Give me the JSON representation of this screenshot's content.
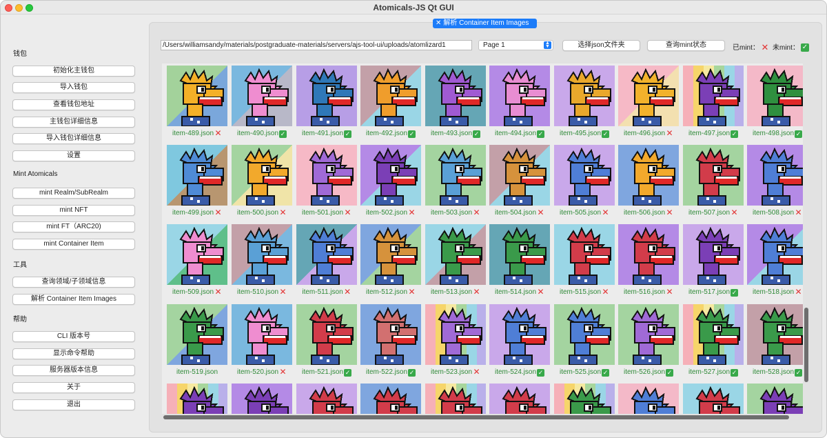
{
  "window": {
    "title": "Atomicals-JS Qt GUI"
  },
  "tab": {
    "label": "解析 Container Item Images",
    "close_glyph": "✕"
  },
  "sidebar": {
    "sections": [
      {
        "title": "钱包",
        "buttons": [
          "初始化主钱包",
          "导入钱包",
          "查看钱包地址",
          "主钱包详细信息",
          "导入钱包详细信息",
          "设置"
        ]
      },
      {
        "title": "Mint Atomicals",
        "buttons": [
          "mint Realm/SubRealm",
          "mint NFT",
          "mint FT（ARC20)",
          "mint Container Item"
        ]
      },
      {
        "title": "工具",
        "buttons": [
          "查询领域/子领域信息",
          "解析 Container Item Images"
        ]
      },
      {
        "title": "帮助",
        "buttons": [
          "CLI 版本号",
          "显示命令帮助",
          "服务器版本信息",
          "关于",
          "退出"
        ]
      }
    ]
  },
  "toolbar": {
    "path_value": "/Users/williamsandy/materials/postgraduate-materials/servers/ajs-tool-ui/uploads/atomlizard1",
    "page_select": "Page 1",
    "select_json_button": "选择json文件夹",
    "query_mint_button": "查询mint状态",
    "minted_label": "已mint：",
    "minted_icon": "red-cross-icon",
    "unminted_label": "未mint：",
    "unminted_icon": "green-check-icon"
  },
  "colors": {
    "accent": "#1c7cf9",
    "minted": "#e23434",
    "unminted": "#38a94a",
    "caption": "#2f8a38"
  },
  "items": [
    {
      "label": "item-489.json",
      "status": "minted",
      "bg": [
        "#a3d29b",
        "#7aa7db"
      ],
      "lizard": "#f4b028",
      "stripe": false
    },
    {
      "label": "item-490.json",
      "status": "unminted",
      "bg": [
        "#7ab8df",
        "#b8b8c8"
      ],
      "lizard": "#ef8dd0",
      "stripe": false
    },
    {
      "label": "item-491.json",
      "status": "unminted",
      "bg": [
        "#b79ee6",
        "#b79ee6"
      ],
      "lizard": "#2f78b8",
      "stripe": false
    },
    {
      "label": "item-492.json",
      "status": "unminted",
      "bg": [
        "#c3a0a8",
        "#9ad6e6"
      ],
      "lizard": "#ef9d2c",
      "stripe": false
    },
    {
      "label": "item-493.json",
      "status": "unminted",
      "bg": [
        "#65a6b5",
        "#65a6b5"
      ],
      "lizard": "#a05ad2",
      "stripe": false
    },
    {
      "label": "item-494.json",
      "status": "unminted",
      "bg": [
        "#b48ae6",
        "#b48ae6"
      ],
      "lizard": "#e88dd2",
      "stripe": false
    },
    {
      "label": "item-495.json",
      "status": "unminted",
      "bg": [
        "#c9a8ea",
        "#c9a8ea"
      ],
      "lizard": "#e9a82c",
      "stripe": false
    },
    {
      "label": "item-496.json",
      "status": "minted",
      "bg": [
        "#f6b9c6",
        "#f3e0b0"
      ],
      "lizard": "#f2b22c",
      "stripe": false
    },
    {
      "label": "item-497.json",
      "status": "unminted",
      "bg": [
        "#f6d56a",
        "#a7d69c"
      ],
      "lizard": "#7b3fb6",
      "stripe": true
    },
    {
      "label": "item-498.json",
      "status": "unminted",
      "bg": [
        "#f4b9c8",
        "#f4b9c8"
      ],
      "lizard": "#2f8f3f",
      "stripe": false
    },
    {
      "label": "item-499.json",
      "status": "minted",
      "bg": [
        "#7fc8df",
        "#b89670"
      ],
      "lizard": "#4f8bd6",
      "stripe": false
    },
    {
      "label": "item-500.json",
      "status": "minted",
      "bg": [
        "#a4d4a0",
        "#f0e4a8"
      ],
      "lizard": "#f2a92c",
      "stripe": false
    },
    {
      "label": "item-501.json",
      "status": "minted",
      "bg": [
        "#f6b9c6",
        "#f6b9c6"
      ],
      "lizard": "#a06ad6",
      "stripe": false
    },
    {
      "label": "item-502.json",
      "status": "minted",
      "bg": [
        "#b48ae6",
        "#9ad6e6"
      ],
      "lizard": "#7b3fb6",
      "stripe": false
    },
    {
      "label": "item-503.json",
      "status": "minted",
      "bg": [
        "#a4d4a0",
        "#a4d4a0"
      ],
      "lizard": "#5aa0d6",
      "stripe": false
    },
    {
      "label": "item-504.json",
      "status": "minted",
      "bg": [
        "#c3a0a8",
        "#9ad6e6"
      ],
      "lizard": "#d6923c",
      "stripe": false
    },
    {
      "label": "item-505.json",
      "status": "minted",
      "bg": [
        "#c9a8ea",
        "#c9a8ea"
      ],
      "lizard": "#4f7ed6",
      "stripe": false
    },
    {
      "label": "item-506.json",
      "status": "minted",
      "bg": [
        "#7fa6df",
        "#7fa6df"
      ],
      "lizard": "#f2a92c",
      "stripe": false
    },
    {
      "label": "item-507.json",
      "status": "minted",
      "bg": [
        "#a4d4a0",
        "#a4d4a0"
      ],
      "lizard": "#d23c4a",
      "stripe": false
    },
    {
      "label": "item-508.json",
      "status": "minted",
      "bg": [
        "#b48ae6",
        "#b48ae6"
      ],
      "lizard": "#4f7ed6",
      "stripe": false
    },
    {
      "label": "item-509.json",
      "status": "minted",
      "bg": [
        "#9ad6e6",
        "#5fbf8a"
      ],
      "lizard": "#ef8dd0",
      "stripe": false
    },
    {
      "label": "item-510.json",
      "status": "minted",
      "bg": [
        "#c3a0a8",
        "#7ab8df"
      ],
      "lizard": "#5aa0d6",
      "stripe": false
    },
    {
      "label": "item-511.json",
      "status": "minted",
      "bg": [
        "#65a6b5",
        "#c9a8ea"
      ],
      "lizard": "#4f7ed6",
      "stripe": false
    },
    {
      "label": "item-512.json",
      "status": "minted",
      "bg": [
        "#7fa6df",
        "#a4d4a0"
      ],
      "lizard": "#d6923c",
      "stripe": false
    },
    {
      "label": "item-513.json",
      "status": "minted",
      "bg": [
        "#9ad6e6",
        "#c3a0a8"
      ],
      "lizard": "#3a9a4a",
      "stripe": false
    },
    {
      "label": "item-514.json",
      "status": "minted",
      "bg": [
        "#65a6b5",
        "#65a6b5"
      ],
      "lizard": "#3a9a4a",
      "stripe": false
    },
    {
      "label": "item-515.json",
      "status": "minted",
      "bg": [
        "#9ad6e6",
        "#9ad6e6"
      ],
      "lizard": "#d23c4a",
      "stripe": false
    },
    {
      "label": "item-516.json",
      "status": "minted",
      "bg": [
        "#b48ae6",
        "#b48ae6"
      ],
      "lizard": "#d23c4a",
      "stripe": false
    },
    {
      "label": "item-517.json",
      "status": "unminted",
      "bg": [
        "#c9a8ea",
        "#c9a8ea"
      ],
      "lizard": "#7b3fb6",
      "stripe": false
    },
    {
      "label": "item-518.json",
      "status": "minted",
      "bg": [
        "#b48ae6",
        "#9ad6e6"
      ],
      "lizard": "#4f7ed6",
      "stripe": false
    },
    {
      "label": "item-519.json",
      "status": "none",
      "bg": [
        "#a4d4a0",
        "#7fa6df"
      ],
      "lizard": "#3a9a4a",
      "stripe": false
    },
    {
      "label": "item-520.json",
      "status": "minted",
      "bg": [
        "#7ab8df",
        "#7ab8df"
      ],
      "lizard": "#ef8dd0",
      "stripe": false
    },
    {
      "label": "item-521.json",
      "status": "unminted",
      "bg": [
        "#a4d4a0",
        "#a4d4a0"
      ],
      "lizard": "#d23c4a",
      "stripe": false
    },
    {
      "label": "item-522.json",
      "status": "unminted",
      "bg": [
        "#7fa6df",
        "#7fa6df"
      ],
      "lizard": "#d27070",
      "stripe": false
    },
    {
      "label": "item-523.json",
      "status": "minted",
      "bg": [
        "#f6d56a",
        "#a7d69c"
      ],
      "lizard": "#a06ad6",
      "stripe": true
    },
    {
      "label": "item-524.json",
      "status": "unminted",
      "bg": [
        "#c9a8ea",
        "#c9a8ea"
      ],
      "lizard": "#4f7ed6",
      "stripe": false
    },
    {
      "label": "item-525.json",
      "status": "unminted",
      "bg": [
        "#a4d4a0",
        "#a4d4a0"
      ],
      "lizard": "#4f7ed6",
      "stripe": false
    },
    {
      "label": "item-526.json",
      "status": "unminted",
      "bg": [
        "#a4d4a0",
        "#a4d4a0"
      ],
      "lizard": "#a06ad6",
      "stripe": false
    },
    {
      "label": "item-527.json",
      "status": "unminted",
      "bg": [
        "#f6d56a",
        "#a7d69c"
      ],
      "lizard": "#3a9a4a",
      "stripe": true
    },
    {
      "label": "item-528.json",
      "status": "unminted",
      "bg": [
        "#c3a0a8",
        "#c3a0a8"
      ],
      "lizard": "#3a9a4a",
      "stripe": false
    },
    {
      "label": "",
      "status": "none",
      "bg": [
        "#f6d56a",
        "#a7d69c"
      ],
      "lizard": "#7b3fb6",
      "stripe": true
    },
    {
      "label": "",
      "status": "none",
      "bg": [
        "#b48ae6",
        "#b48ae6"
      ],
      "lizard": "#7b3fb6",
      "stripe": false
    },
    {
      "label": "",
      "status": "none",
      "bg": [
        "#c9a8ea",
        "#c9a8ea"
      ],
      "lizard": "#d23c4a",
      "stripe": false
    },
    {
      "label": "",
      "status": "none",
      "bg": [
        "#7fa6df",
        "#7fa6df"
      ],
      "lizard": "#d23c4a",
      "stripe": false
    },
    {
      "label": "",
      "status": "none",
      "bg": [
        "#f6d56a",
        "#a7d69c"
      ],
      "lizard": "#d23c4a",
      "stripe": true
    },
    {
      "label": "",
      "status": "none",
      "bg": [
        "#c9a8ea",
        "#c9a8ea"
      ],
      "lizard": "#d23c4a",
      "stripe": false
    },
    {
      "label": "",
      "status": "none",
      "bg": [
        "#f6d56a",
        "#a7d69c"
      ],
      "lizard": "#3a9a4a",
      "stripe": true
    },
    {
      "label": "",
      "status": "none",
      "bg": [
        "#f4b9c8",
        "#f4b9c8"
      ],
      "lizard": "#4f7ed6",
      "stripe": false
    },
    {
      "label": "",
      "status": "none",
      "bg": [
        "#9ad6e6",
        "#9ad6e6"
      ],
      "lizard": "#d23c4a",
      "stripe": false
    },
    {
      "label": "",
      "status": "none",
      "bg": [
        "#a4d4a0",
        "#a4d4a0"
      ],
      "lizard": "#7b3fb6",
      "stripe": false
    }
  ]
}
